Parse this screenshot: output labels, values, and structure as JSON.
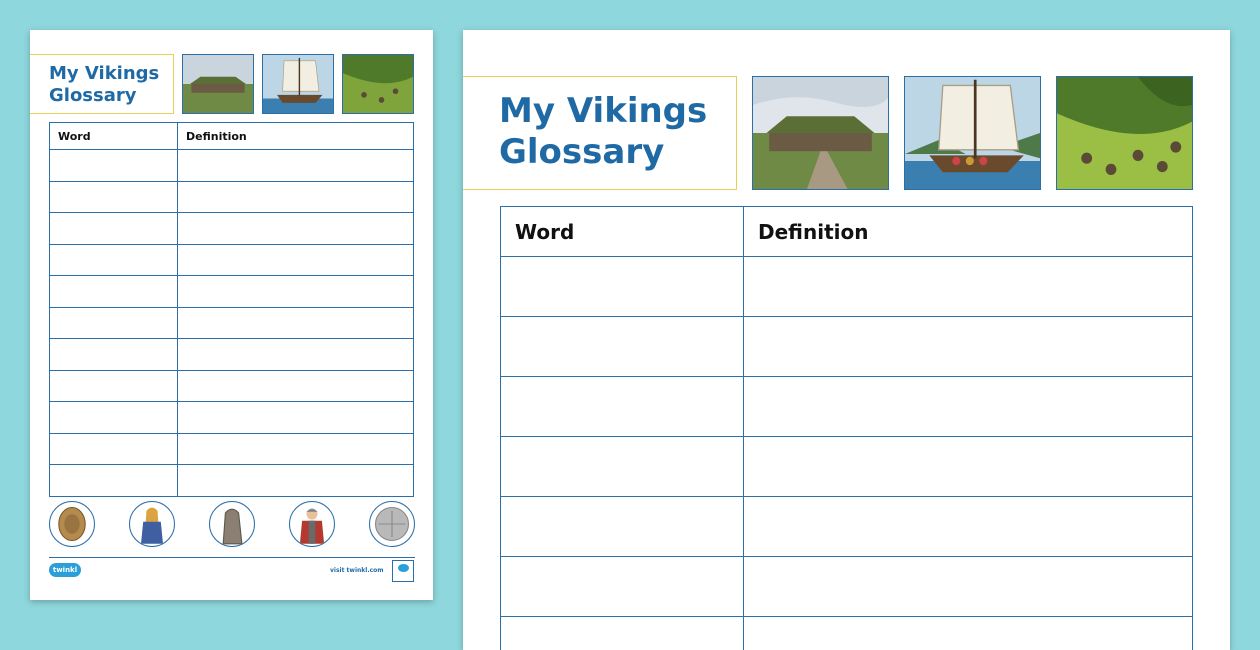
{
  "small_page": {
    "title_line1": "My Vikings",
    "title_line2": "Glossary",
    "col_word": "Word",
    "col_definition": "Definition",
    "footer_logo": "twinkl",
    "footer_url": "visit twinkl.com"
  },
  "large_page": {
    "title_line1": "My Vikings",
    "title_line2": "Glossary",
    "col_word": "Word",
    "col_definition": "Definition"
  },
  "illustrations": [
    "longhouse",
    "viking-longship",
    "viking-village-hillside"
  ],
  "circle_illustrations": [
    "brooch",
    "viking-woman",
    "rune-stone",
    "viking-warrior",
    "silver-coin"
  ],
  "colors": {
    "background": "#8ed7dc",
    "title_text": "#1f6aa5",
    "title_border": "#e8cf5a",
    "table_border": "#2a6fa8"
  }
}
